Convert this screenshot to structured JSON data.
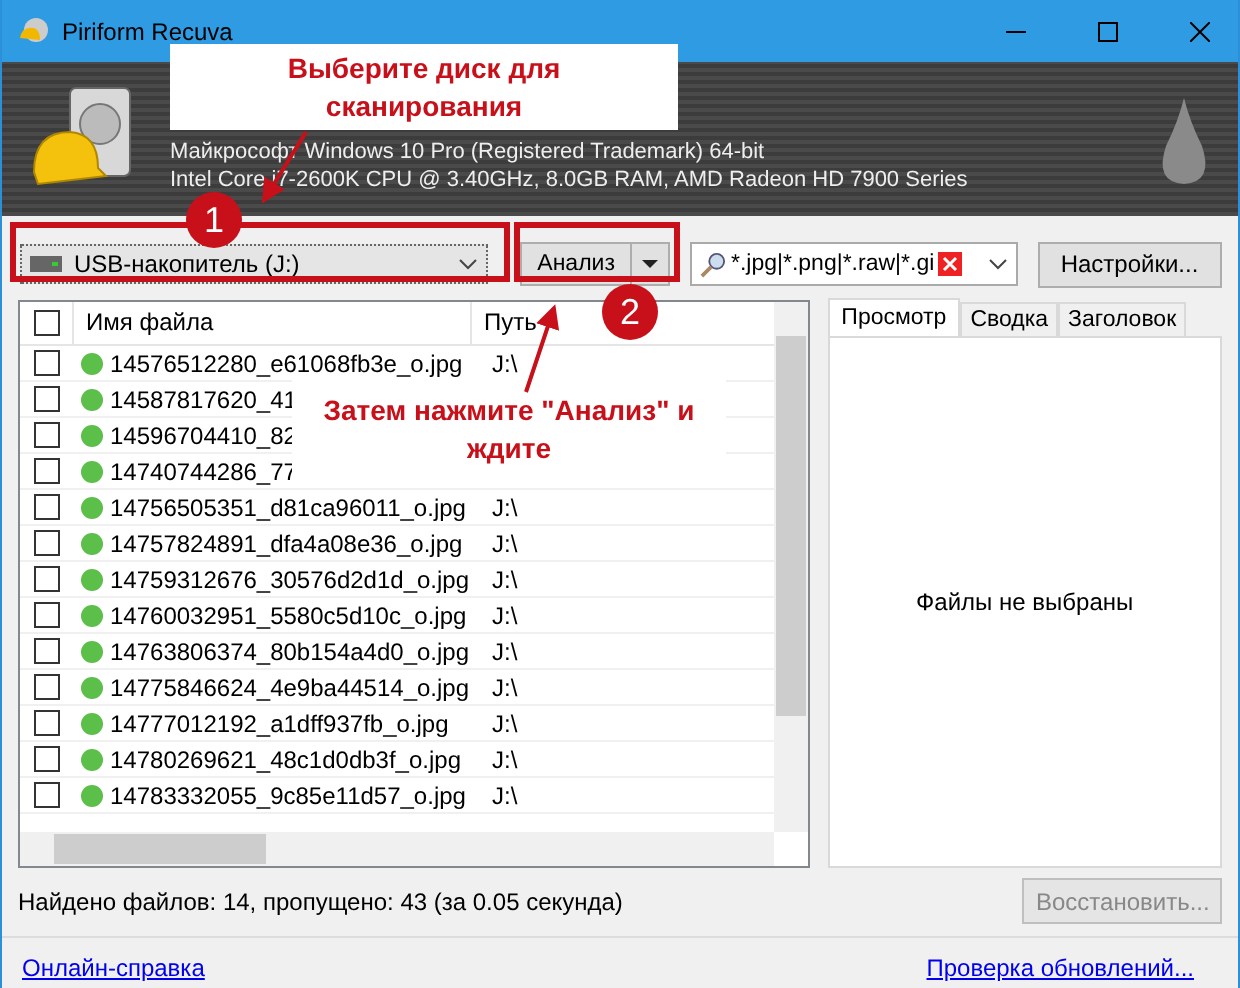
{
  "window": {
    "title": "Piriform Recuva"
  },
  "header": {
    "lines": [
      "Майкрософт Windows 10 Pro (Registered Trademark) 64-bit",
      "Intel Core i7-2600K CPU @ 3.40GHz, 8.0GB RAM, AMD Radeon HD 7900 Series"
    ]
  },
  "toolbar": {
    "drive": "USB-накопитель (J:)",
    "analyze": "Анализ",
    "filter": "*.jpg|*.png|*.raw|*.gi",
    "settings": "Настройки..."
  },
  "table": {
    "columns": [
      "Имя файла",
      "Путь"
    ],
    "all_checked": false,
    "rows": [
      {
        "name": "14576512280_e61068fb3e_o.jpg",
        "path": "J:\\",
        "checked": false
      },
      {
        "name": "14587817620_41",
        "checked": false
      },
      {
        "name": "14596704410_82",
        "checked": false
      },
      {
        "name": "14740744286_77",
        "checked": false
      },
      {
        "name": "14756505351_d81ca96011_o.jpg",
        "path": "J:\\",
        "checked": false
      },
      {
        "name": "14757824891_dfa4a08e36_o.jpg",
        "path": "J:\\",
        "checked": false
      },
      {
        "name": "14759312676_30576d2d1d_o.jpg",
        "path": "J:\\",
        "checked": false
      },
      {
        "name": "14760032951_5580c5d10c_o.jpg",
        "path": "J:\\",
        "checked": false
      },
      {
        "name": "14763806374_80b154a4d0_o.jpg",
        "path": "J:\\",
        "checked": false
      },
      {
        "name": "14775846624_4e9ba44514_o.jpg",
        "path": "J:\\",
        "checked": false
      },
      {
        "name": "14777012192_a1dff937fb_o.jpg",
        "path": "J:\\",
        "checked": false
      },
      {
        "name": "14780269621_48c1d0db3f_o.jpg",
        "path": "J:\\",
        "checked": false
      },
      {
        "name": "14783332055_9c85e11d57_o.jpg",
        "path": "J:\\",
        "checked": false
      }
    ]
  },
  "tabs": [
    {
      "label": "Просмотр",
      "selected": true
    },
    {
      "label": "Сводка",
      "selected": false
    },
    {
      "label": "Заголовок",
      "selected": false
    }
  ],
  "preview_message": "Файлы не выбраны",
  "status": "Найдено файлов: 14, пропущено: 43 (за 0.05 секунда)",
  "recover_button": {
    "label": "Восстановить...",
    "disabled": true
  },
  "links": [
    "Онлайн-справка",
    "Проверка обновлений..."
  ],
  "callouts": [
    {
      "number": "1",
      "text": "Выберите диск для сканирования"
    },
    {
      "number": "2",
      "text": "Затем нажмите \"Анализ\" и ждите"
    }
  ]
}
